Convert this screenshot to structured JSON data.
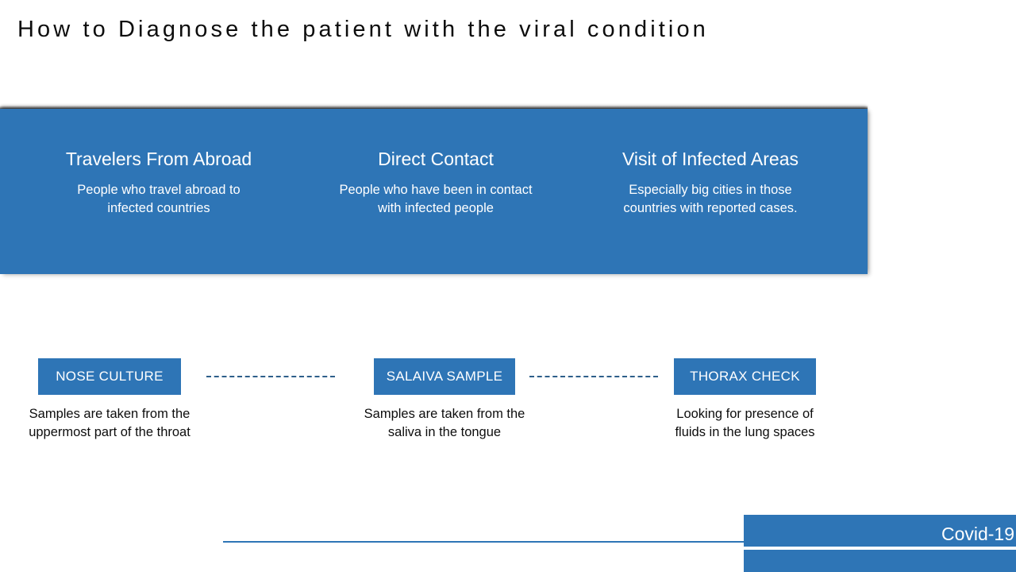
{
  "slide": {
    "title": "How to Diagnose the patient with the viral condition",
    "accent_color": "#2e75b6",
    "background_color": "#ffffff",
    "text_color": "#0d0d0d"
  },
  "causes_panel": {
    "background_color": "#2e75b6",
    "columns": [
      {
        "heading": "Travelers From Abroad",
        "body": "People who travel abroad to  infected countries"
      },
      {
        "heading": "Direct Contact",
        "body": "People who have been in contact with infected people"
      },
      {
        "heading": "Visit of Infected Areas",
        "body": "Especially big cities in those countries with reported cases."
      }
    ]
  },
  "diagnosis_steps": {
    "connector_style": "dashed",
    "connector_color": "#2e5f8a",
    "steps": [
      {
        "label": "NOSE CULTURE",
        "description": "Samples are taken from the uppermost part of the throat"
      },
      {
        "label": "SALAIVA SAMPLE",
        "description": "Samples are taken from the saliva in the tongue"
      },
      {
        "label": "THORAX CHECK",
        "description": "Looking for presence of fluids in the lung spaces"
      }
    ]
  },
  "footer": {
    "label": "Covid-19",
    "bar_color": "#2e75b6",
    "rule_color": "#2e75b6"
  }
}
